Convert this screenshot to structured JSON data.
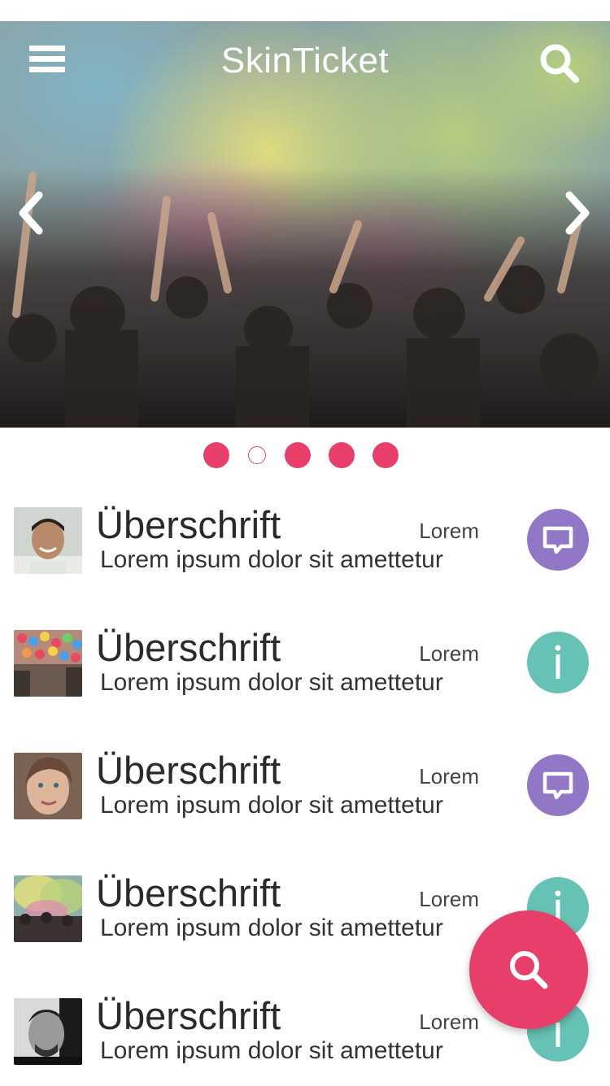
{
  "app": {
    "title": "SkinTicket"
  },
  "icons": {
    "menu": "menu-icon",
    "search": "search-icon",
    "prev": "chevron-left-icon",
    "next": "chevron-right-icon",
    "chat": "chat-bubble-icon",
    "info": "info-icon",
    "fab": "search-icon"
  },
  "carousel": {
    "slide_count": 5,
    "active_index": 1
  },
  "colors": {
    "accent": "#e83f6a",
    "chat_action": "#9277c6",
    "info_action": "#66c2b5"
  },
  "items": [
    {
      "title": "Überschrift",
      "meta": "Lorem",
      "description": "Lorem ipsum dolor sit amettetur",
      "action": "chat"
    },
    {
      "title": "Überschrift",
      "meta": "Lorem",
      "description": "Lorem ipsum dolor sit amettetur",
      "action": "info"
    },
    {
      "title": "Überschrift",
      "meta": "Lorem",
      "description": "Lorem ipsum dolor sit amettetur",
      "action": "chat"
    },
    {
      "title": "Überschrift",
      "meta": "Lorem",
      "description": "Lorem ipsum dolor sit amettetur",
      "action": "info"
    },
    {
      "title": "Überschrift",
      "meta": "Lorem",
      "description": "Lorem ipsum dolor sit amettetur",
      "action": "info"
    }
  ]
}
